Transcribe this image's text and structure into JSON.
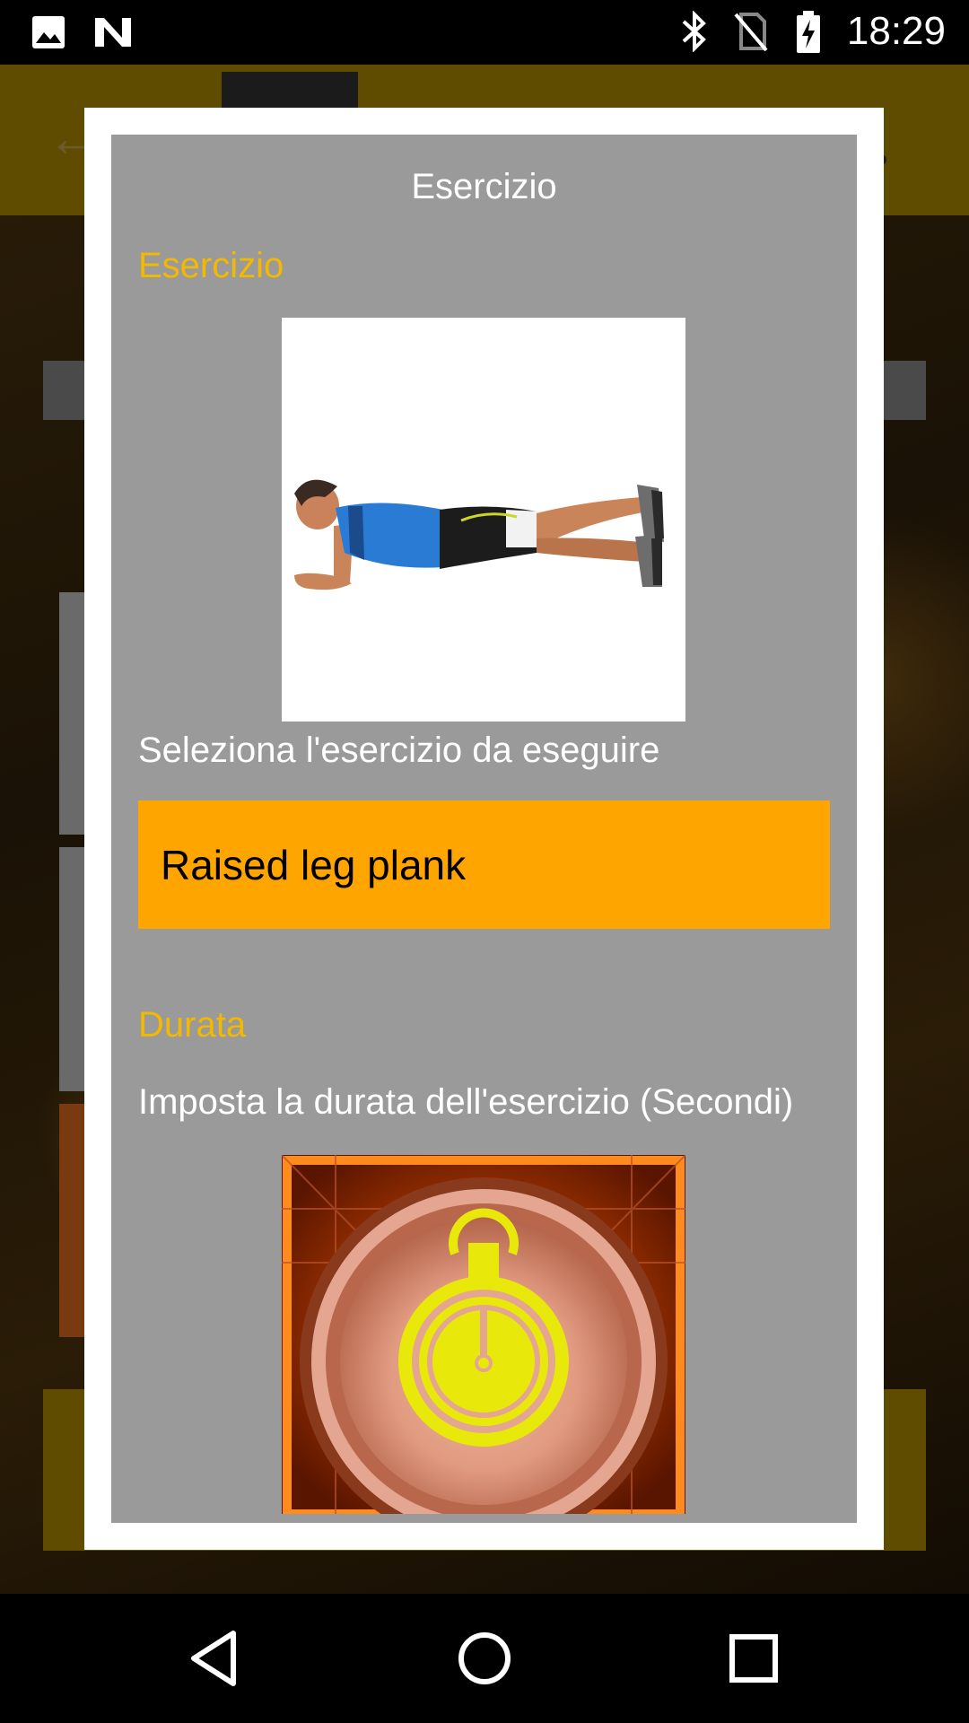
{
  "status_bar": {
    "time": "18:29",
    "left_icons": [
      "image-icon",
      "n-icon"
    ],
    "right_icons": [
      "bluetooth-icon",
      "no-sim-icon",
      "battery-charging-icon"
    ]
  },
  "dialog": {
    "title": "Esercizio",
    "exercise_section": {
      "label": "Esercizio",
      "image": "plank-exercise-image",
      "description": "Seleziona l'esercizio da eseguire",
      "selected_exercise": "Raised leg plank"
    },
    "duration_section": {
      "label": "Durata",
      "description": "Imposta la durata dell'esercizio (Secondi)",
      "image": "stopwatch-image"
    }
  },
  "colors": {
    "section_label": "#f3b800",
    "select_background": "#ffa500",
    "dialog_background": "#9a9a9a",
    "dialog_border": "#ffffff"
  },
  "nav_bar": {
    "buttons": [
      "back-icon",
      "home-icon",
      "recents-icon"
    ]
  }
}
